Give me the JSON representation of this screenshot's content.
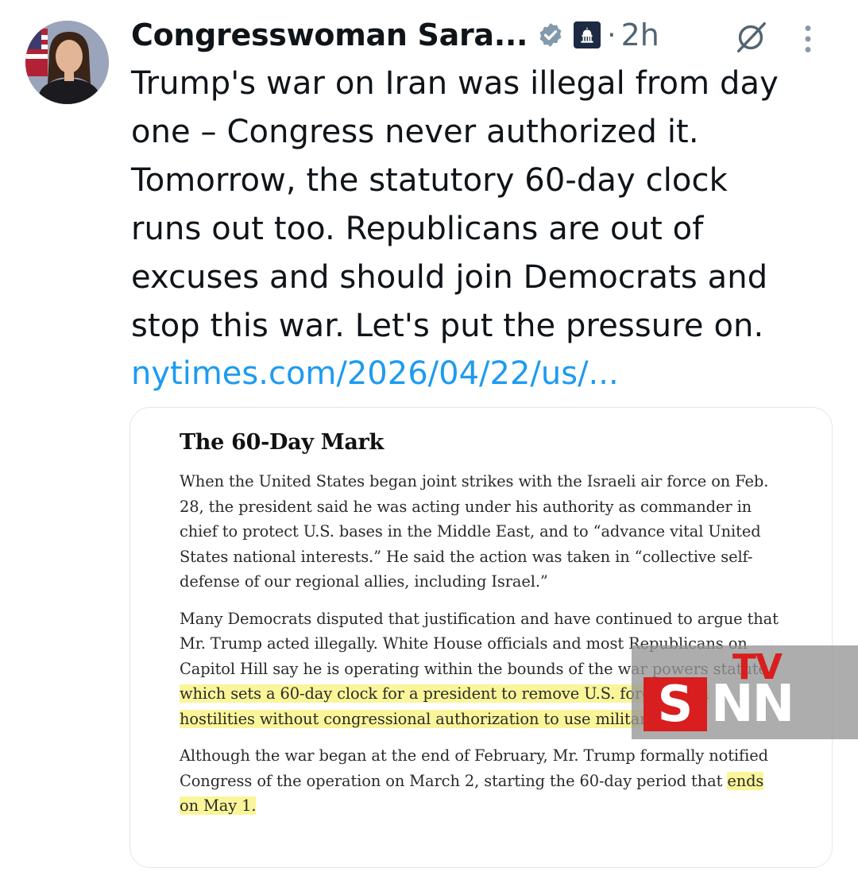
{
  "post": {
    "author_name": "Congresswoman Sara...",
    "separator": "·",
    "time": "2h",
    "text": "Trump's war on Iran was illegal from day\none – Congress never authorized it.\nTomorrow, the statutory 60-day clock\nruns out too. Republicans are out of\nexcuses and should join Democrats and\nstop this war. Let's put the pressure on.",
    "link": "nytimes.com/2026/04/22/us/..."
  },
  "icons": {
    "verified": "verified-badge-icon",
    "government": "government-affiliation-icon",
    "grok": "grok-icon",
    "more": "more-options-icon"
  },
  "article": {
    "title": "The 60-Day Mark",
    "p1": "When the United States began joint strikes with the Israeli air force on Feb. 28, the president said he was acting under his authority as commander in chief to protect U.S. bases in the Middle East, and to “advance vital United States national interests.” He said the action was taken in “collective self-defense of our regional allies, including Israel.”",
    "p2_a": "Many Democrats disputed that justification and have continued to argue that Mr. Trump acted illegally. White House officials and most Republicans on Capitol Hill say he is operating within the bounds of the war powers statute, ",
    "p2_highlight": "which sets a 60-day clock for a president to remove U.S. forces from hostilities without congressional authorization to use military force.",
    "p3_a": "Although the war began at the end of February, Mr. Trump formally notified Congress of the operation on March 2, starting the 60-day period that ",
    "p3_highlight": "ends on May 1."
  },
  "watermark": {
    "tv": "TV",
    "s": "S",
    "nn": "NN"
  },
  "colors": {
    "link": "#1d9bf0",
    "verified": "#829aab",
    "highlight": "#fbf59a",
    "watermark_red": "#d81e1e"
  }
}
